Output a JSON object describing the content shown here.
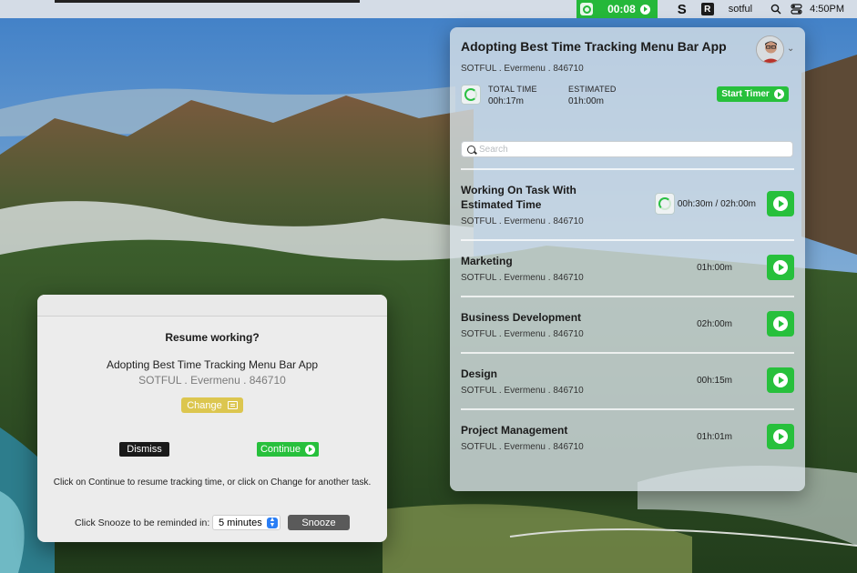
{
  "menubar": {
    "timer": "00:08",
    "s_icon": "S",
    "r_icon": "R",
    "user": "sotful",
    "clock": "4:50PM"
  },
  "popover": {
    "title": "Adopting Best Time Tracking Menu Bar App",
    "subtitle": "SOTFUL . Evermenu . 846710",
    "total_time_label": "TOTAL TIME",
    "total_time_value": "00h:17m",
    "estimated_label": "ESTIMATED",
    "estimated_value": "01h:00m",
    "start_timer_label": "Start Timer",
    "search_placeholder": "Search",
    "tasks": [
      {
        "name_line1": "Working On Task With",
        "name_line2": "Estimated Time",
        "sub": "SOTFUL . Evermenu . 846710",
        "time": "00h:30m / 02h:00m"
      },
      {
        "name_line1": "Marketing",
        "sub": "SOTFUL . Evermenu . 846710",
        "time": "01h:00m"
      },
      {
        "name_line1": "Business Development",
        "sub": "SOTFUL . Evermenu . 846710",
        "time": "02h:00m"
      },
      {
        "name_line1": "Design",
        "sub": "SOTFUL . Evermenu . 846710",
        "time": "00h:15m"
      },
      {
        "name_line1": "Project Management",
        "sub": "SOTFUL . Evermenu . 846710",
        "time": "01h:01m"
      }
    ]
  },
  "dialog": {
    "heading": "Resume working?",
    "task": "Adopting Best Time Tracking Menu Bar App",
    "sub": "SOTFUL . Evermenu . 846710",
    "change_label": "Change",
    "dismiss_label": "Dismiss",
    "continue_label": "Continue",
    "hint": "Click on Continue to resume tracking time, or click on Change for another task.",
    "snooze_label": "Click Snooze to be reminded in:",
    "snooze_value": "5 minutes",
    "snooze_button": "Snooze"
  },
  "colors": {
    "accent_green": "#27c03c",
    "change_yellow": "#dcc64f",
    "dismiss_black": "#1a1a1a",
    "snooze_gray": "#5a5a5a"
  }
}
